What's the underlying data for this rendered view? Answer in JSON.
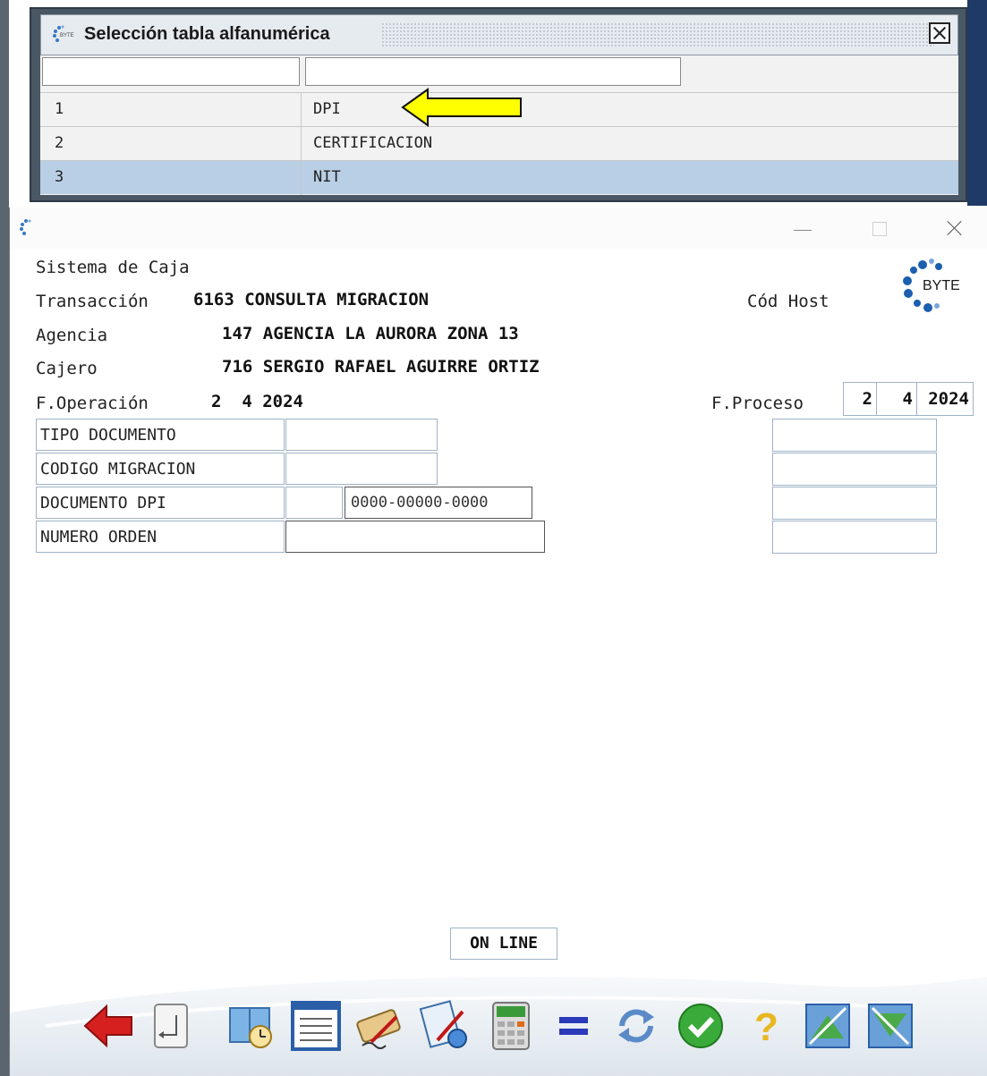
{
  "popup": {
    "title": "Selección tabla alfanumérica",
    "rows": [
      {
        "code": "1",
        "desc": "DPI"
      },
      {
        "code": "2",
        "desc": "CERTIFICACION"
      },
      {
        "code": "3",
        "desc": "NIT"
      }
    ],
    "selected_row": 3,
    "annotation": "yellow arrow pointing at DPI"
  },
  "main": {
    "system_title": "Sistema de Caja",
    "transaccion_label": "Transacción",
    "transaccion_value": "6163 CONSULTA MIGRACION",
    "cod_host_label": "Cód Host",
    "agencia_label": "Agencia",
    "agencia_value": "147 AGENCIA LA AURORA ZONA 13",
    "cajero_label": "Cajero",
    "cajero_value": "716 SERGIO RAFAEL AGUIRRE ORTIZ",
    "f_operacion_label": "F.Operación",
    "f_operacion_value": "2  4 2024",
    "f_proceso_label": "F.Proceso",
    "f_proceso_day": "2",
    "f_proceso_month": "4",
    "f_proceso_year": "2024",
    "logo_text": "BYTE",
    "fields": {
      "tipo_documento": "TIPO DOCUMENTO",
      "codigo_migracion": "CODIGO MIGRACION",
      "documento_dpi": "DOCUMENTO DPI",
      "documento_dpi_value": "0000-00000-0000",
      "numero_orden": "NUMERO ORDEN"
    },
    "status": "ON LINE"
  },
  "toolbar": {
    "icons": [
      "back-arrow-icon",
      "enter-key-icon",
      "book-clock-icon",
      "notepad-icon",
      "signature-icon",
      "document-pen-icon",
      "calculator-icon",
      "equals-icon",
      "refresh-icon",
      "check-icon",
      "help-icon",
      "export-icon",
      "import-icon"
    ]
  },
  "colors": {
    "popup_frame": "#4a5866",
    "selected_row": "#b9cfe5",
    "field_border": "#9fb3c8",
    "arrow_fill": "#ffff00"
  }
}
